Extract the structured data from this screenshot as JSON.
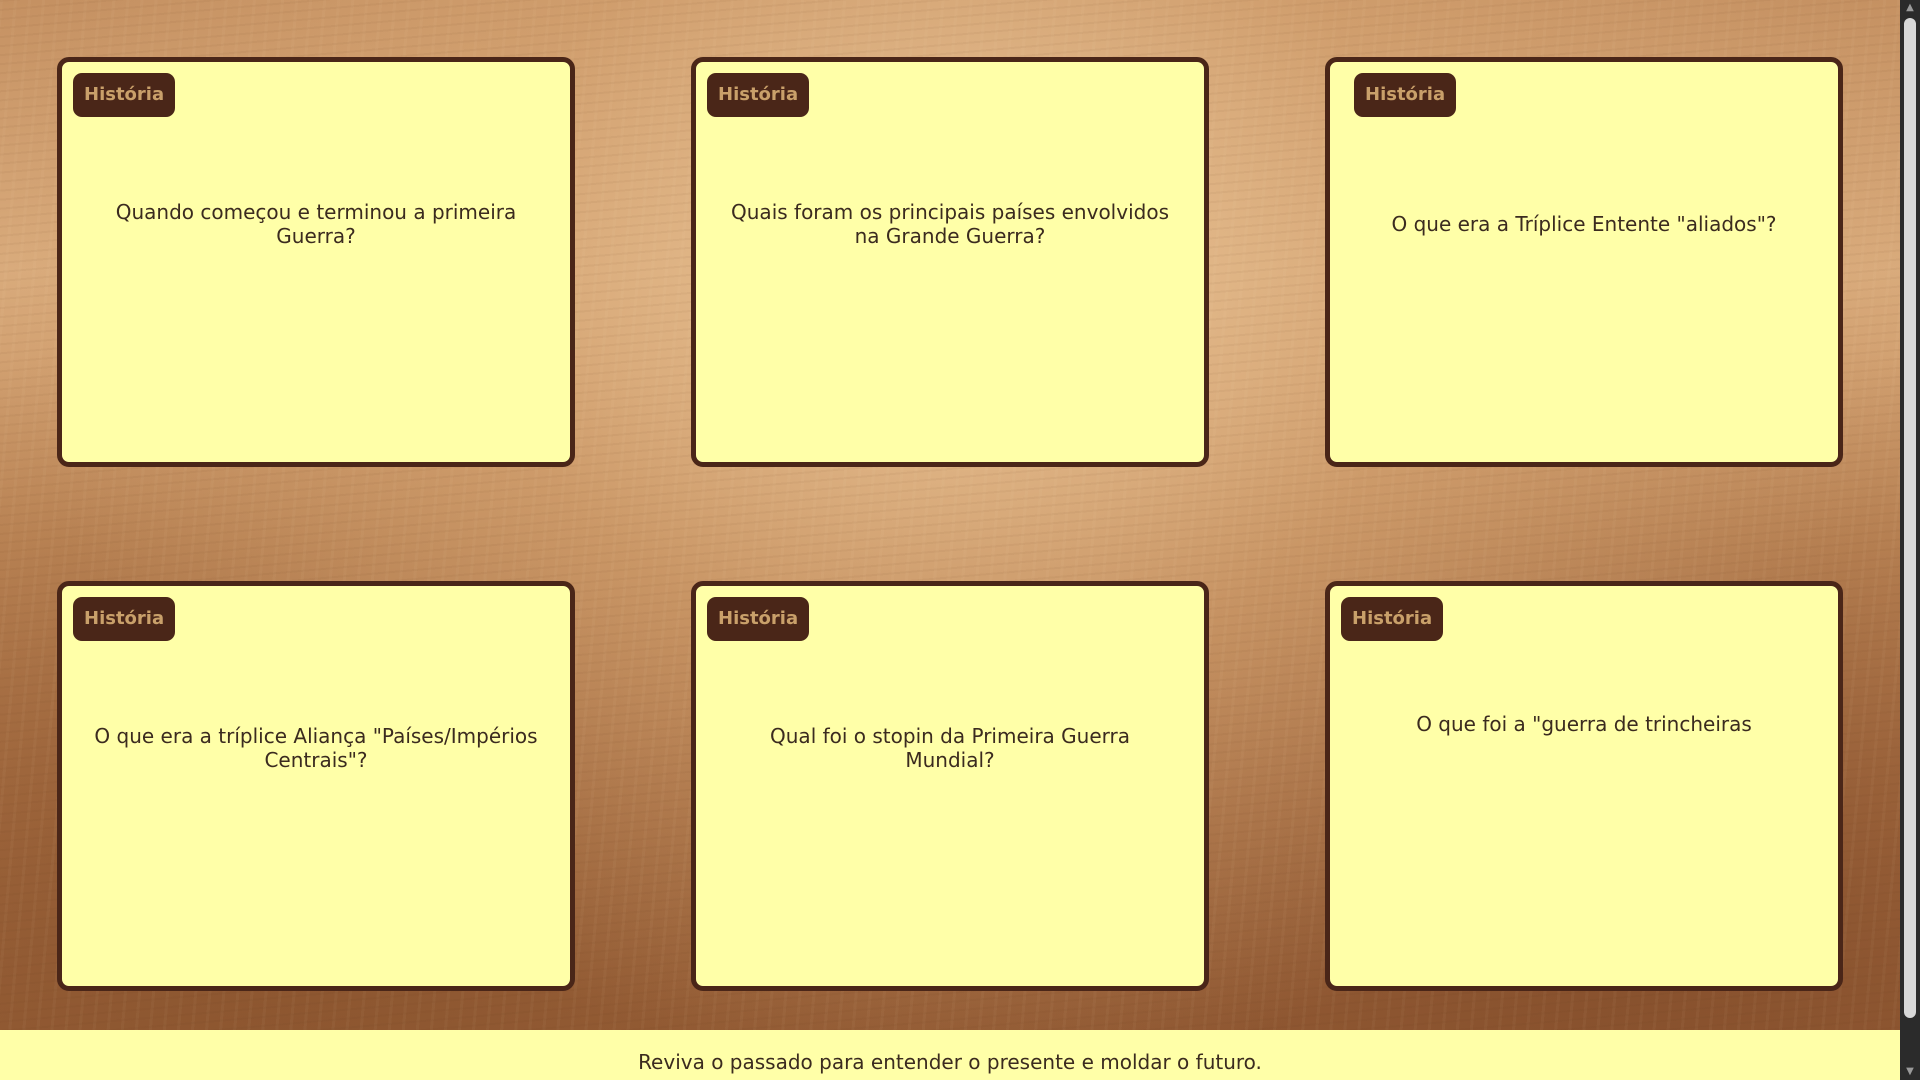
{
  "cards": [
    {
      "tag": "História",
      "question": "Quando começou e terminou a primeira Guerra?"
    },
    {
      "tag": "História",
      "question": "Quais foram os principais países envolvidos na Grande Guerra?"
    },
    {
      "tag": "História",
      "question": "O que era a Tríplice Entente \"aliados\"?"
    },
    {
      "tag": "História",
      "question": "O que era a tríplice Aliança \"Países/Impérios Centrais\"?"
    },
    {
      "tag": "História",
      "question": "Qual foi o stopin da Primeira Guerra Mundial?"
    },
    {
      "tag": "História",
      "question": "O que foi a \"guerra de trincheiras"
    }
  ],
  "footer": {
    "text": "Reviva o passado para entender o presente e moldar o futuro."
  },
  "scrollbar": {
    "up_icon": "chevron-up-icon",
    "down_icon": "chevron-down-icon"
  }
}
